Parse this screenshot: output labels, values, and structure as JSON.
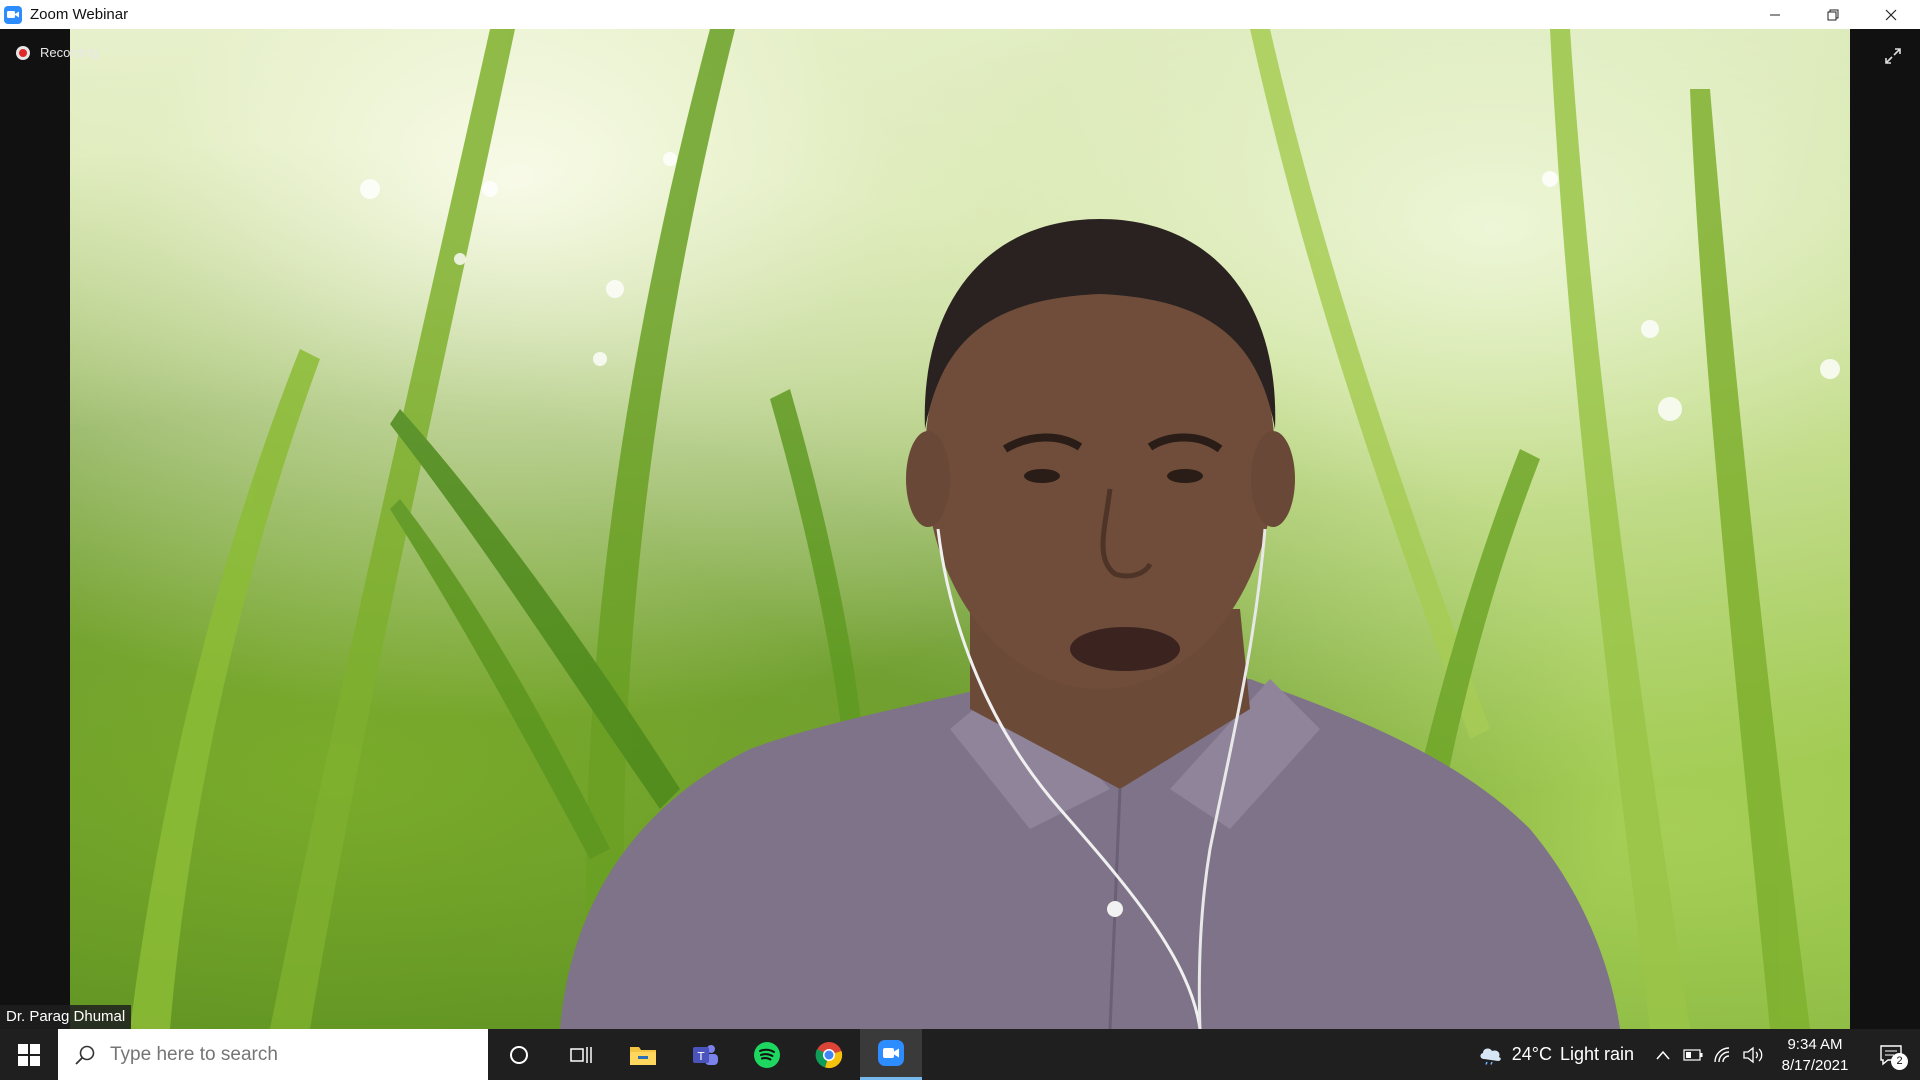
{
  "window": {
    "title": "Zoom Webinar",
    "controls": [
      "minimize",
      "restore",
      "close"
    ]
  },
  "meeting": {
    "recording_label": "Recording",
    "participant_name": "Dr. Parag Dhumal"
  },
  "taskbar": {
    "search_placeholder": "Type here to search",
    "pinned_apps": [
      "cortana",
      "task-view",
      "file-explorer",
      "teams",
      "spotify",
      "chrome",
      "zoom"
    ],
    "weather": {
      "temperature": "24°C",
      "condition": "Light rain"
    },
    "time": "9:34 AM",
    "date": "8/17/2021",
    "notification_count": "2"
  },
  "colors": {
    "zoom_blue": "#2d8cff",
    "taskbar": "#1f1f1f",
    "record_red": "#e02828",
    "active_underline": "#76b9ed"
  }
}
